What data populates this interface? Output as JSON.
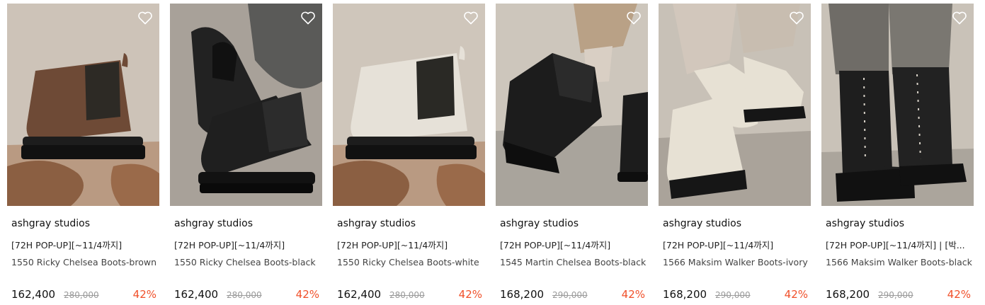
{
  "products": [
    {
      "brand": "ashgray studios",
      "promo": "[72H POP-UP][~11/4까지]",
      "name": "1550 Ricky Chelsea Boots-brown",
      "price": "162,400",
      "original_price": "280,000",
      "discount": "42%",
      "boot_color": "#6e4a36"
    },
    {
      "brand": "ashgray studios",
      "promo": "[72H POP-UP][~11/4까지]",
      "name": "1550 Ricky Chelsea Boots-black",
      "price": "162,400",
      "original_price": "280,000",
      "discount": "42%",
      "boot_color": "#1f1f1f"
    },
    {
      "brand": "ashgray studios",
      "promo": "[72H POP-UP][~11/4까지]",
      "name": "1550 Ricky Chelsea Boots-white",
      "price": "162,400",
      "original_price": "280,000",
      "discount": "42%",
      "boot_color": "#e6e1d8"
    },
    {
      "brand": "ashgray studios",
      "promo": "[72H POP-UP][~11/4까지]",
      "name": "1545 Martin Chelsea Boots-black",
      "price": "168,200",
      "original_price": "290,000",
      "discount": "42%",
      "boot_color": "#1c1c1c"
    },
    {
      "brand": "ashgray studios",
      "promo": "[72H POP-UP][~11/4까지]",
      "name": "1566 Maksim Walker Boots-ivory",
      "price": "168,200",
      "original_price": "290,000",
      "discount": "42%",
      "boot_color": "#e7e1d4"
    },
    {
      "brand": "ashgray studios",
      "promo": "[72H POP-UP][~11/4까지] | [박...",
      "name": "1566 Maksim Walker Boots-black",
      "price": "168,200",
      "original_price": "290,000",
      "discount": "42%",
      "boot_color": "#1e1e1e"
    }
  ],
  "colors": {
    "discount": "#f0502a",
    "original_price": "#9a9a9a",
    "heart_icon": "#ffffff"
  }
}
